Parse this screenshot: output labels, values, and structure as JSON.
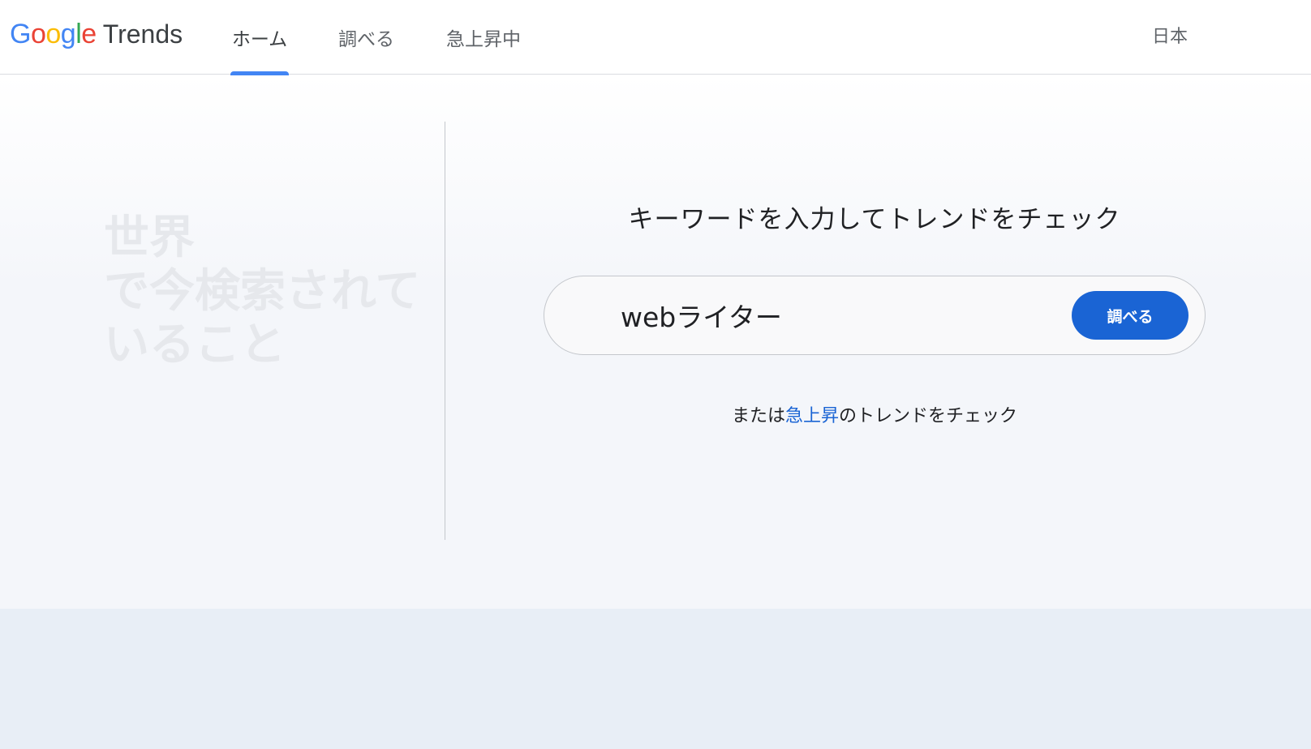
{
  "header": {
    "logo": {
      "google_letters": [
        "G",
        "o",
        "o",
        "g",
        "l",
        "e"
      ],
      "trends_label": "Trends"
    },
    "tabs": [
      {
        "label": "ホーム",
        "active": true
      },
      {
        "label": "調べる",
        "active": false
      },
      {
        "label": "急上昇中",
        "active": false
      }
    ],
    "region_label": "日本"
  },
  "hero": {
    "title_lines": [
      "世界",
      "で今検索されて",
      "いること"
    ],
    "prompt": "キーワードを入力してトレンドをチェック",
    "search": {
      "value": "webライター",
      "button_label": "調べる"
    },
    "subline": {
      "prefix": "または",
      "link": "急上昇",
      "suffix": "のトレンドをチェック"
    }
  },
  "colors": {
    "accent": "#4285f4",
    "button": "#1a64d4",
    "link": "#1a64d4",
    "logo_blue": "#4285f4",
    "logo_red": "#ea4335",
    "logo_yellow": "#fbbc05",
    "logo_green": "#34a853"
  }
}
